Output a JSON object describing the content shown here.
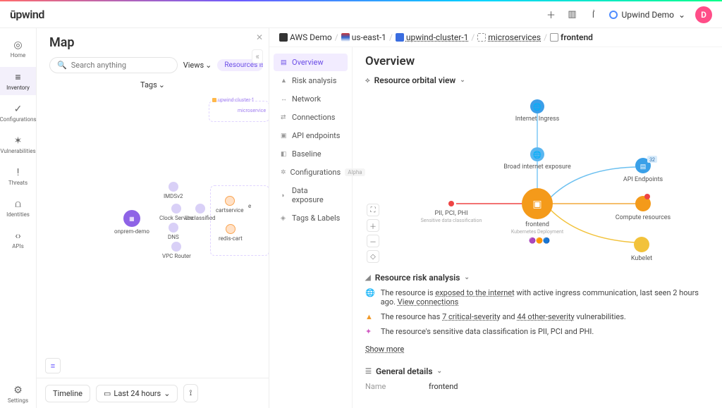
{
  "brand": "ūpwind",
  "workspace": {
    "name": "Upwind Demo",
    "avatar_letter": "D"
  },
  "rail": [
    {
      "icon": "◎",
      "label": "Home"
    },
    {
      "icon": "≡",
      "label": "Inventory"
    },
    {
      "icon": "✓",
      "label": "Configurations"
    },
    {
      "icon": "✶",
      "label": "Vulnerabilities"
    },
    {
      "icon": "!",
      "label": "Threats"
    },
    {
      "icon": "⩍",
      "label": "Identities"
    },
    {
      "icon": "‹›",
      "label": "APIs"
    }
  ],
  "rail_bottom": {
    "icon": "⚙",
    "label": "Settings"
  },
  "map": {
    "title": "Map",
    "search_placeholder": "Search anything",
    "views_label": "Views",
    "filter_chip": "Resources is not \"coredns\"",
    "tags_label": "Tags",
    "cluster_label": "upwind-cluster-1",
    "microservice_label": "microservice",
    "nodes": {
      "onprem": "onprem-demo",
      "imds": "IMDSv2",
      "clock": "Clock Service",
      "unclassified": "Unclassified",
      "dns": "DNS",
      "vpc": "VPC Router",
      "cartservice": "cartservice",
      "rediscart": "redis-cart",
      "e": "e"
    },
    "timeline_label": "Timeline",
    "range_label": "Last 24 hours"
  },
  "crumbs": [
    {
      "icon": "aws",
      "text": "AWS Demo",
      "link": false
    },
    {
      "icon": "flag",
      "text": "us-east-1",
      "link": false
    },
    {
      "icon": "blue",
      "text": "upwind-cluster-1",
      "link": true
    },
    {
      "icon": "dash",
      "text": "microservices",
      "link": true
    },
    {
      "icon": "box",
      "text": "frontend",
      "link": false,
      "bold": true
    }
  ],
  "detail_nav": [
    {
      "icon": "▤",
      "label": "Overview",
      "active": true
    },
    {
      "icon": "▲",
      "label": "Risk analysis"
    },
    {
      "icon": "↔",
      "label": "Network"
    },
    {
      "icon": "⇄",
      "label": "Connections"
    },
    {
      "icon": "▣",
      "label": "API endpoints"
    },
    {
      "icon": "◧",
      "label": "Baseline"
    },
    {
      "icon": "✲",
      "label": "Configurations",
      "badge": "Alpha"
    },
    {
      "icon": "◑",
      "label": "Data exposure"
    },
    {
      "icon": "◈",
      "label": "Tags & Labels"
    }
  ],
  "overview_title": "Overview",
  "orbital": {
    "heading": "Resource orbital view",
    "center": {
      "name": "frontend",
      "sub": "Kubernetes Deployment"
    },
    "top1": "Internet Ingress",
    "top2": "Broad internet exposure",
    "left": {
      "name": "PII, PCI, PHI",
      "sub": "Sensitive data classification"
    },
    "right1": {
      "name": "API Endpoints",
      "badge": "32"
    },
    "right2": "Compute resources",
    "right3": "Kubelet"
  },
  "risk": {
    "heading": "Resource risk analysis",
    "lines": [
      {
        "icon": "🌐",
        "pre": "The resource is ",
        "u1": "exposed to the internet",
        "mid": " with active ingress communication, last seen 2 hours ago. ",
        "u2": "View connections"
      },
      {
        "icon": "▲",
        "pre": "The resource has ",
        "u1": "7 critical-severity",
        "mid": " and ",
        "u2": "44 other-severity",
        "post": " vulnerabilities."
      },
      {
        "icon": "✦",
        "pre": "The resource's sensitive data classification is  PII, PCI and PHI."
      }
    ],
    "show_more": "Show more"
  },
  "general": {
    "heading": "General details",
    "name_key": "Name",
    "name_val": "frontend"
  }
}
